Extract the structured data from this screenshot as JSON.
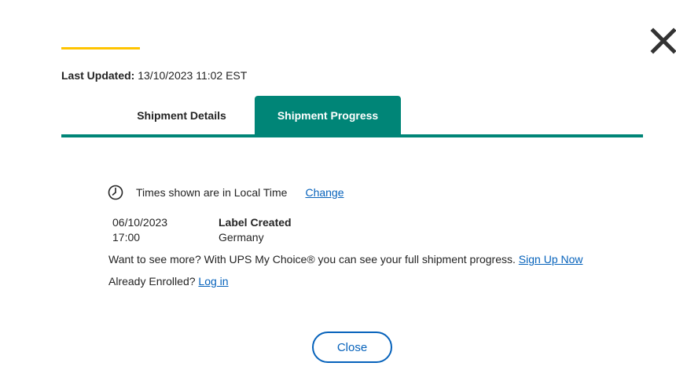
{
  "header": {
    "close_icon": "close-x-icon",
    "last_updated_label": "Last Updated:",
    "last_updated_value": "13/10/2023 11:02 EST"
  },
  "tabs": [
    {
      "label": "Shipment Details",
      "active": false
    },
    {
      "label": "Shipment Progress",
      "active": true
    }
  ],
  "timezone": {
    "icon": "clock-icon",
    "text": "Times shown are in Local Time",
    "change_link": "Change"
  },
  "progress": [
    {
      "date": "06/10/2023",
      "time": "17:00",
      "status": "Label Created",
      "location": "Germany"
    }
  ],
  "upsell": {
    "text": "Want to see more? With UPS My Choice® you can see your full shipment progress.",
    "signup_link": "Sign Up Now"
  },
  "enrolled": {
    "text": "Already Enrolled?",
    "login_link": "Log in"
  },
  "footer": {
    "close_label": "Close"
  },
  "colors": {
    "accent_yellow": "#ffc400",
    "tab_teal": "#008577",
    "link_blue": "#0662bb",
    "text": "#242424"
  }
}
